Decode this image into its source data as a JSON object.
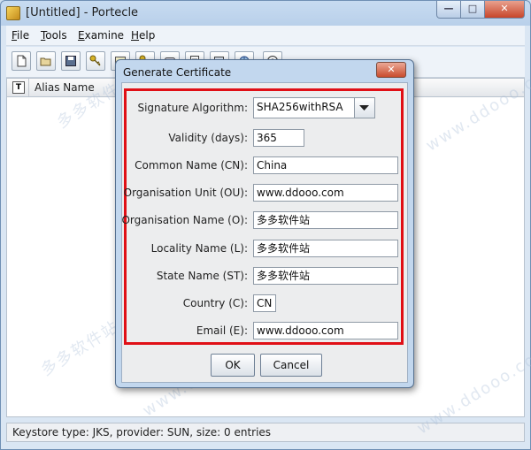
{
  "window": {
    "title": "[Untitled] - Portecle",
    "minimize": "—",
    "maximize": "□",
    "close": "✕"
  },
  "menu": [
    {
      "label": "File",
      "mnemonic": "F",
      "rest": "ile"
    },
    {
      "label": "Tools",
      "mnemonic": "T",
      "rest": "ools"
    },
    {
      "label": "Examine",
      "mnemonic": "E",
      "rest": "xamine"
    },
    {
      "label": "Help",
      "mnemonic": "H",
      "rest": "elp"
    }
  ],
  "toolbar": {
    "icons": [
      "new-keystore-icon",
      "open-keystore-icon",
      "save-keystore-icon",
      "generate-keypair-icon",
      "import-trusted-certificate-icon",
      "import-keypair-icon",
      "examine-certificate-icon",
      "examine-csr-icon",
      "examine-crl-icon",
      "examine-ssl-icon",
      "help-icon"
    ]
  },
  "table": {
    "type_header": "T",
    "alias_header": "Alias Name"
  },
  "status": "Keystore type: JKS, provider: SUN, size: 0 entries",
  "dialog": {
    "title": "Generate Certificate",
    "close": "✕",
    "signature_algorithm": {
      "label": "Signature Algorithm:",
      "value": "SHA256withRSA"
    },
    "validity": {
      "label": "Validity (days):",
      "value": "365"
    },
    "common_name": {
      "label": "Common Name (CN):",
      "value": "China"
    },
    "org_unit": {
      "label": "Organisation Unit (OU):",
      "value": "www.ddooo.com"
    },
    "org_name": {
      "label": "Organisation Name (O):",
      "value": "多多软件站"
    },
    "locality": {
      "label": "Locality Name (L):",
      "value": "多多软件站"
    },
    "state": {
      "label": "State Name (ST):",
      "value": "多多软件站"
    },
    "country": {
      "label": "Country (C):",
      "value": "CN"
    },
    "email": {
      "label": "Email (E):",
      "value": "www.ddooo.com"
    },
    "ok": "OK",
    "cancel": "Cancel"
  },
  "watermark": [
    "多多软件站",
    "www.ddooo.com"
  ],
  "colors": {
    "highlight": "#e00f16",
    "title_bg": "#c2d7ee"
  }
}
